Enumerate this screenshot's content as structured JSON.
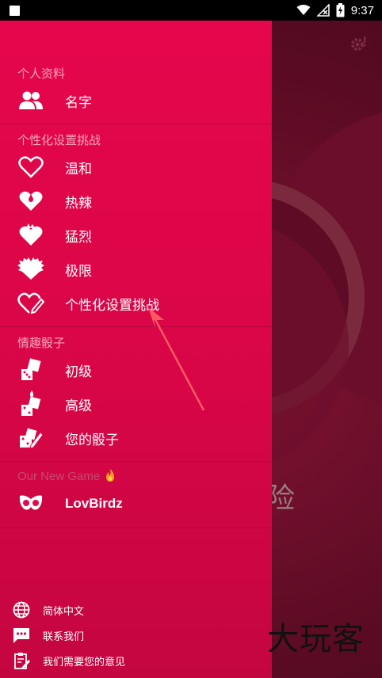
{
  "status_bar": {
    "time": "9:37"
  },
  "background": {
    "title_fragment": "险"
  },
  "watermark": "大玩客",
  "drawer": {
    "profile": {
      "header": "个人资料",
      "items": [
        {
          "label": "名字",
          "icon": "people-icon"
        }
      ]
    },
    "custom": {
      "header": "个性化设置挑战",
      "items": [
        {
          "label": "温和",
          "icon": "heart-outline-icon"
        },
        {
          "label": "热辣",
          "icon": "heart-drop-icon"
        },
        {
          "label": "猛烈",
          "icon": "heart-flame-icon"
        },
        {
          "label": "极限",
          "icon": "heart-spiky-icon"
        },
        {
          "label": "个性化设置挑战",
          "icon": "heart-pencil-icon"
        }
      ]
    },
    "dice": {
      "header": "情趣骰子",
      "items": [
        {
          "label": "初级",
          "icon": "dice-icon"
        },
        {
          "label": "高级",
          "icon": "dice-fire-icon"
        },
        {
          "label": "您的骰子",
          "icon": "dice-pencil-icon"
        }
      ]
    },
    "new_game": {
      "header": "Our New Game",
      "header_icon": "fire-icon",
      "items": [
        {
          "label": "LovBirdz",
          "icon": "lovbirdz-mask-icon"
        }
      ]
    },
    "bottom": [
      {
        "label": "简体中文",
        "icon": "globe-icon"
      },
      {
        "label": "联系我们",
        "icon": "chat-icon"
      },
      {
        "label": "我们需要您的意见",
        "icon": "feedback-icon"
      }
    ]
  },
  "colors": {
    "drawer_top": "#e6064c",
    "drawer_bottom": "#c40640",
    "section_header": "#f3a4b9",
    "arrow": "#ff5a62"
  }
}
